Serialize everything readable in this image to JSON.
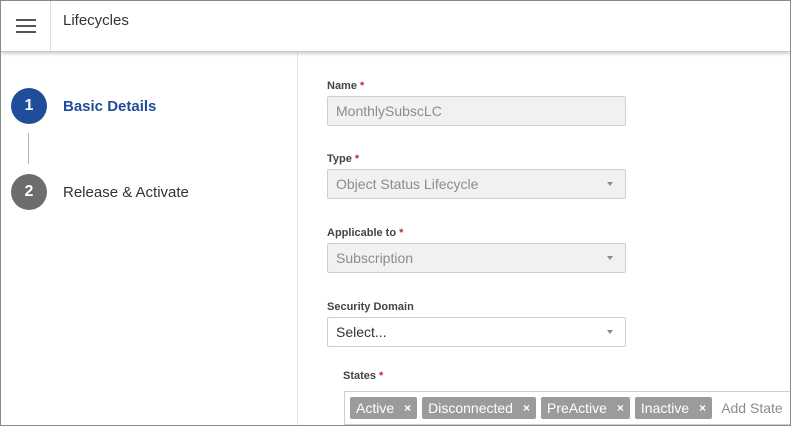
{
  "header": {
    "menu_icon": "hamburger-menu-icon",
    "title": "Lifecycles"
  },
  "stepper": {
    "steps": [
      {
        "number": "1",
        "label": "Basic Details",
        "active": true
      },
      {
        "number": "2",
        "label": "Release & Activate",
        "active": false
      }
    ]
  },
  "form": {
    "name": {
      "label": "Name",
      "required_mark": "*",
      "value": "MonthlySubscLC"
    },
    "type": {
      "label": "Type",
      "required_mark": "*",
      "value": "Object Status Lifecycle"
    },
    "applicable_to": {
      "label": "Applicable to",
      "required_mark": "*",
      "value": "Subscription"
    },
    "security_domain": {
      "label": "Security Domain",
      "value": "Select..."
    },
    "states": {
      "label": "States",
      "required_mark": "*",
      "chips": [
        "Active",
        "Disconnected",
        "PreActive",
        "Inactive"
      ],
      "remove_glyph": "×",
      "placeholder": "Add State"
    }
  },
  "colors": {
    "active_step": "#1f4d9a",
    "inactive_step": "#6d6d6d",
    "required": "#c62828",
    "chip": "#9b9b9b"
  }
}
